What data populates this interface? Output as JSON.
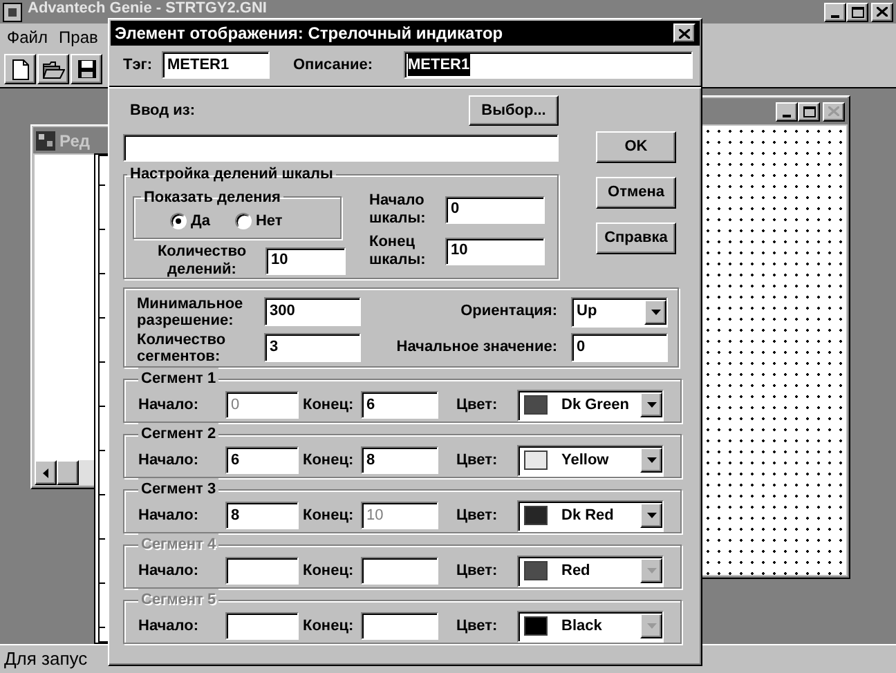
{
  "app": {
    "title": "Advantech Genie - STRTGY2.GNI",
    "menu": [
      {
        "label": "Файл"
      },
      {
        "label": "Прав"
      }
    ],
    "toolbar": [
      {
        "kind": "new"
      },
      {
        "kind": "open"
      },
      {
        "kind": "save"
      }
    ],
    "status_bar": "Для запус"
  },
  "left_window": {
    "title": "Ред"
  },
  "right_window": {
    "close_disabled": true
  },
  "dialog": {
    "title": "Элемент отображения: Стрелочный индикатор",
    "tag": {
      "label": "Тэг:",
      "value": "METER1"
    },
    "description": {
      "label": "Описание:",
      "value": "METER1",
      "selected": true
    },
    "input_from": {
      "label": "Ввод из:",
      "button": "Выбор..."
    },
    "buttons": [
      "OK",
      "Отмена",
      "Справка"
    ],
    "scale": {
      "title": "Настройка делений шкалы",
      "show_ticks": {
        "title": "Показать деления",
        "options": [
          {
            "label": "Да",
            "selected": true
          },
          {
            "label": "Нет",
            "selected": false
          }
        ]
      },
      "tick_count": {
        "label": "Количество делений:",
        "value": "10"
      },
      "scale_start": {
        "label": "Начало шкалы:",
        "value": "0"
      },
      "scale_end": {
        "label": "Конец шкалы:",
        "value": "10"
      }
    },
    "min_resolution": {
      "label": "Минимальное разрешение:",
      "value": "300"
    },
    "segment_count": {
      "label": "Количество сегментов:",
      "value": "3"
    },
    "orientation": {
      "label": "Ориентация:",
      "value": "Up"
    },
    "initial_value": {
      "label": "Начальное значение:",
      "value": "0"
    },
    "segments": [
      {
        "title": "Сегмент 1",
        "disabled": false,
        "start_label": "Начало:",
        "start": "0",
        "start_disabled": true,
        "end_label": "Конец:",
        "end": "6",
        "end_disabled": false,
        "color_label": "Цвет:",
        "color_name": "Dk Green",
        "color": "#4a4a4a"
      },
      {
        "title": "Сегмент 2",
        "disabled": false,
        "start_label": "Начало:",
        "start": "6",
        "start_disabled": false,
        "end_label": "Конец:",
        "end": "8",
        "end_disabled": false,
        "color_label": "Цвет:",
        "color_name": "Yellow",
        "color": "#e8e8e8"
      },
      {
        "title": "Сегмент 3",
        "disabled": false,
        "start_label": "Начало:",
        "start": "8",
        "start_disabled": false,
        "end_label": "Конец:",
        "end": "10",
        "end_disabled": true,
        "color_label": "Цвет:",
        "color_name": "Dk Red",
        "color": "#262626"
      },
      {
        "title": "Сегмент 4",
        "disabled": true,
        "start_label": "Начало:",
        "end_label": "Конец:",
        "color_label": "Цвет:",
        "color_name": "Red",
        "color": "#4c4c4c"
      },
      {
        "title": "Сегмент 5",
        "disabled": true,
        "start_label": "Начало:",
        "end_label": "Конец:",
        "color_label": "Цвет:",
        "color_name": "Black",
        "color": "#000000"
      }
    ]
  }
}
